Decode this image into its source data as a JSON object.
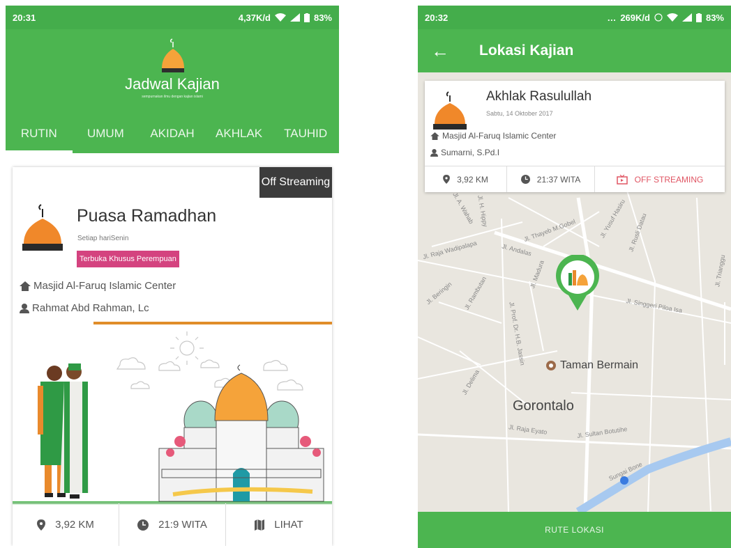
{
  "left": {
    "status": {
      "time": "20:31",
      "speed": "4,37K/d",
      "battery": "83%"
    },
    "header": {
      "title": "Jadwal Kajian",
      "tagline": "sempurnakan ilmu dengan kajian islami"
    },
    "tabs": [
      {
        "label": "RUTIN",
        "active": true
      },
      {
        "label": "UMUM"
      },
      {
        "label": "AKIDAH"
      },
      {
        "label": "AKHLAK"
      },
      {
        "label": "TAUHID"
      }
    ],
    "card": {
      "streaming": "Off Streaming",
      "title": "Puasa Ramadhan",
      "schedule": "Setiap hariSenin",
      "badge": "Terbuka Khusus Perempuan",
      "location": "Masjid Al-Faruq Islamic Center",
      "speaker": "Rahmat Abd Rahman, Lc",
      "distance": "3,92 KM",
      "time": "21:9 WITA",
      "action": "LIHAT"
    },
    "colors": {
      "green": "#4cb550",
      "pink": "#d4437f",
      "orange": "#e08d2a"
    }
  },
  "right": {
    "status": {
      "time": "20:32",
      "speed": "269K/d",
      "battery": "83%"
    },
    "appbar": {
      "title": "Lokasi Kajian"
    },
    "info": {
      "title": "Akhlak Rasulullah",
      "date": "Sabtu, 14 Oktober 2017",
      "location": "Masjid Al-Faruq Islamic Center",
      "speaker": "Sumarni, S.Pd.I",
      "distance": "3,92 KM",
      "time": "21:37 WITA",
      "streaming": "OFF STREAMING"
    },
    "map": {
      "poi": "Taman Bermain",
      "city": "Gorontalo",
      "streets": [
        "Jl. Thayeb M.Gobel",
        "Jl. Andalas",
        "Jl. Raja Wadipalapa",
        "Jl. Beringin",
        "Jl. Rambutan",
        "Jl. Madura",
        "Jl. Prof. Dr. H.B. Jassin",
        "Jl. Delima",
        "Jl. Singgeri Piloa Isa",
        "Jl. Yusuf Hasiru",
        "Jl. Rusli Datau",
        "Jl. Raja Eyato",
        "Jl. Sultan Botutihe",
        "Jl. Trianggu",
        "Sungai Bone",
        "Jl. A. Wahab",
        "Jl. H. Hippy"
      ]
    },
    "route_button": "RUTE LOKASI"
  }
}
